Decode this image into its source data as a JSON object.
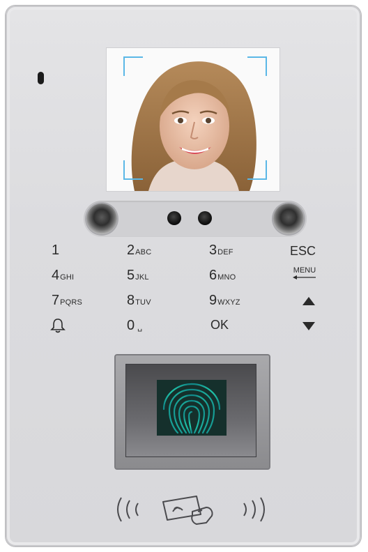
{
  "device": {
    "keys": [
      {
        "id": "key-1",
        "digit": "1",
        "letters": ""
      },
      {
        "id": "key-2",
        "digit": "2",
        "letters": "ABC"
      },
      {
        "id": "key-3",
        "digit": "3",
        "letters": "DEF"
      },
      {
        "id": "key-esc",
        "word": "ESC"
      },
      {
        "id": "key-4",
        "digit": "4",
        "letters": "GHI"
      },
      {
        "id": "key-5",
        "digit": "5",
        "letters": "JKL"
      },
      {
        "id": "key-6",
        "digit": "6",
        "letters": "MNO"
      },
      {
        "id": "key-menu",
        "word": "MENU"
      },
      {
        "id": "key-7",
        "digit": "7",
        "letters": "PQRS"
      },
      {
        "id": "key-8",
        "digit": "8",
        "letters": "TUV"
      },
      {
        "id": "key-9",
        "digit": "9",
        "letters": "WXYZ"
      },
      {
        "id": "key-up",
        "icon": "up-arrow-icon"
      },
      {
        "id": "key-bell",
        "icon": "bell-icon"
      },
      {
        "id": "key-0",
        "digit": "0",
        "letters": "␣"
      },
      {
        "id": "key-ok",
        "word": "OK"
      },
      {
        "id": "key-down",
        "icon": "down-arrow-icon"
      }
    ],
    "colors": {
      "panel": "#dcdcdf",
      "screen_bracket": "#5ab7e6",
      "fingerprint_glow": "#1fe3b4"
    }
  }
}
